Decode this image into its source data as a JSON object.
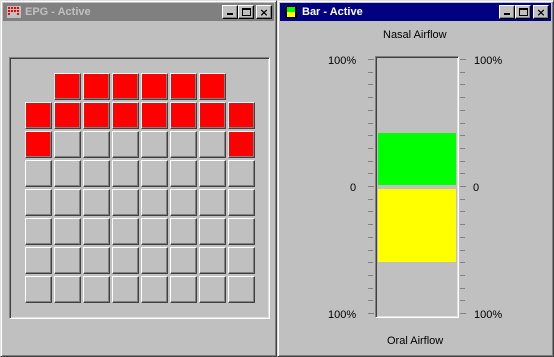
{
  "epg_window": {
    "title": "EPG - Active",
    "icon": "grid-icon",
    "grid": [
      [
        0,
        1,
        1,
        1,
        1,
        1,
        1,
        0
      ],
      [
        1,
        1,
        1,
        1,
        1,
        1,
        1,
        1
      ],
      [
        1,
        0,
        0,
        0,
        0,
        0,
        0,
        1
      ],
      [
        0,
        0,
        0,
        0,
        0,
        0,
        0,
        0
      ],
      [
        0,
        0,
        0,
        0,
        0,
        0,
        0,
        0
      ],
      [
        0,
        0,
        0,
        0,
        0,
        0,
        0,
        0
      ],
      [
        0,
        0,
        0,
        0,
        0,
        0,
        0,
        0
      ],
      [
        0,
        0,
        0,
        0,
        0,
        0,
        0,
        0
      ]
    ],
    "blank_cells": [
      [
        0,
        0
      ],
      [
        0,
        7
      ]
    ],
    "active_color": "#ff0000",
    "inactive_color": "#c0c0c0"
  },
  "bar_window": {
    "title": "Bar - Active",
    "icon": "bar-chart-icon",
    "top_label": "Nasal Airflow",
    "bottom_label": "Oral Airflow",
    "left_top": "100%",
    "left_mid": "0",
    "left_bottom": "100%",
    "right_top": "100%",
    "right_mid": "0",
    "right_bottom": "100%",
    "nasal_level": 0.41,
    "oral_level": 0.57,
    "nasal_color": "#00ff00",
    "oral_color": "#ffff00"
  },
  "caption_buttons": {
    "minimize": "minimize-icon",
    "maximize": "maximize-icon",
    "close": "×"
  }
}
